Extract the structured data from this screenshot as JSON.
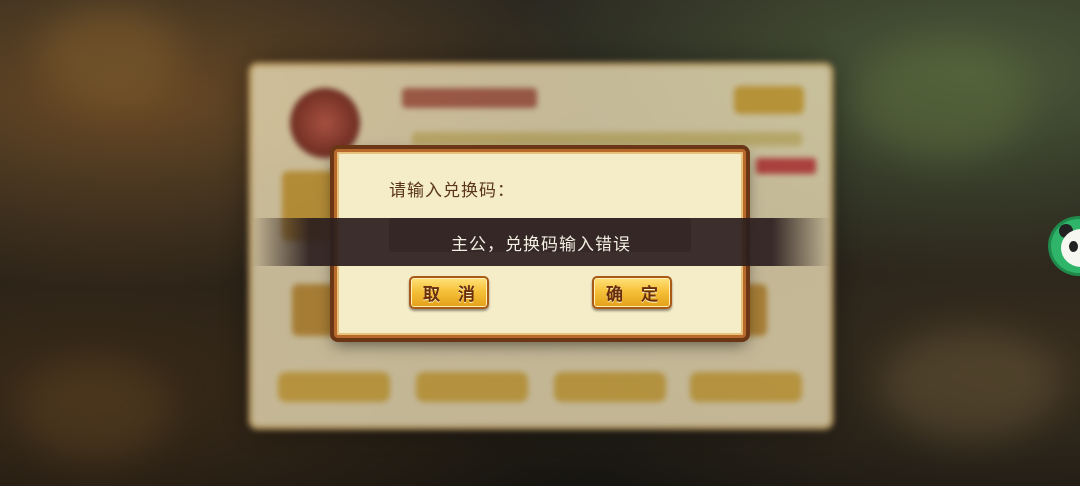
{
  "dialog": {
    "prompt": "请输入兑换码：",
    "code_input_value": "",
    "cancel_label": "取 消",
    "confirm_label": "确 定"
  },
  "toast": {
    "message": "主公，兑换码输入错误"
  },
  "icons": {
    "floating_helper": "panda-icon"
  },
  "colors": {
    "dialog_background": "#f5ecc8",
    "dialog_border": "#b86a2c",
    "button_gold": "#f6c13a",
    "button_text": "#6a2e0c",
    "toast_background": "#2b1e1e"
  }
}
